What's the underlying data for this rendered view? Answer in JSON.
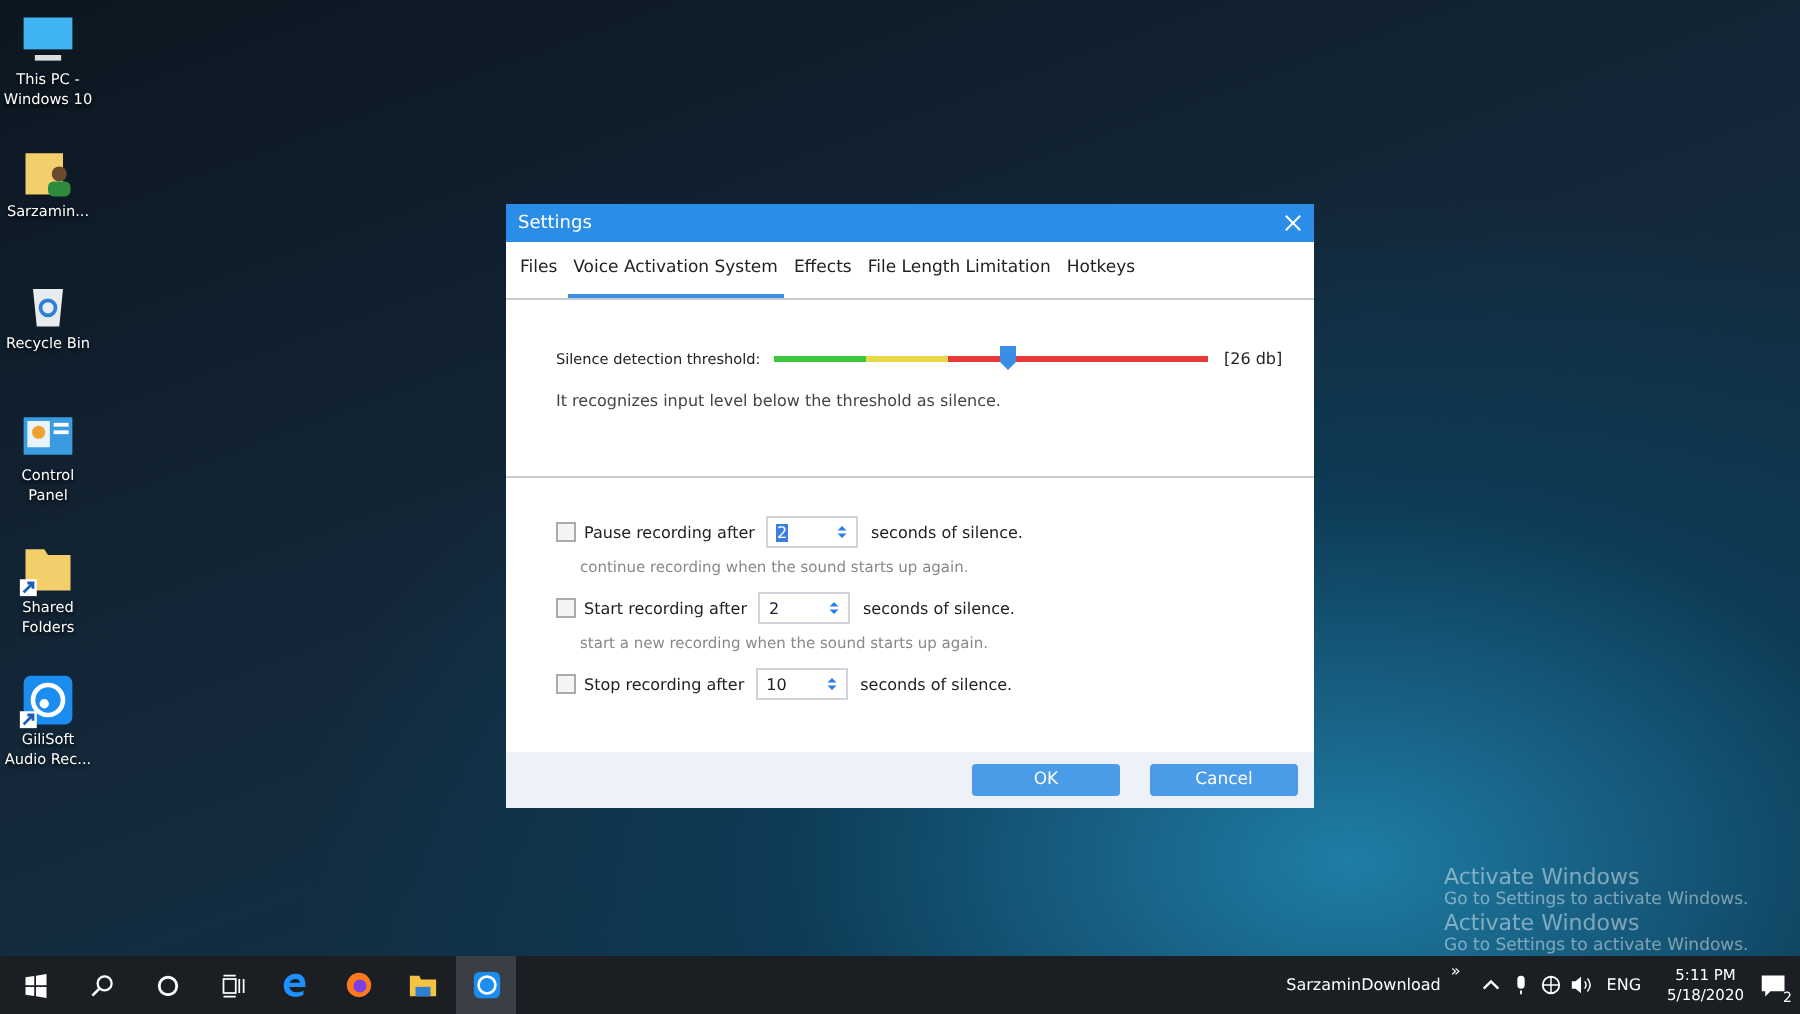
{
  "desktop_icons": [
    {
      "kind": "pc",
      "label": "This PC - Windows 10",
      "shortcut": false
    },
    {
      "kind": "user-folder",
      "label": "Sarzamin...",
      "shortcut": false
    },
    {
      "kind": "recycle-bin",
      "label": "Recycle Bin",
      "shortcut": false
    },
    {
      "kind": "control-panel",
      "label": "Control Panel",
      "shortcut": false
    },
    {
      "kind": "folder",
      "label": "Shared Folders",
      "shortcut": true
    },
    {
      "kind": "app",
      "label": "GiliSoft Audio Rec...",
      "shortcut": true
    }
  ],
  "watermark": [
    "Activate Windows",
    "Go to Settings to activate Windows.",
    "Activate Windows",
    "Go to Settings to activate Windows."
  ],
  "dialog": {
    "title": "Settings",
    "tabs": [
      {
        "label": "Files",
        "selected": false
      },
      {
        "label": "Voice Activation System",
        "selected": true
      },
      {
        "label": "Effects",
        "selected": false
      },
      {
        "label": "File Length Limitation",
        "selected": false
      },
      {
        "label": "Hotkeys",
        "selected": false
      }
    ],
    "threshold": {
      "label": "Silence detection threshold:",
      "level": 0.54,
      "reading": "[26 db]",
      "hint": "It recognizes input level below the threshold as silence."
    },
    "options": [
      {
        "label": "Pause recording after",
        "value": "2",
        "suffix": "seconds of silence.",
        "checked": false,
        "hint": "continue recording when the sound starts up again."
      },
      {
        "label": "Start recording after",
        "value": "2",
        "suffix": "seconds of silence.",
        "checked": false,
        "hint": "start a new recording when the sound starts up again."
      },
      {
        "label": "Stop recording after",
        "value": "10",
        "suffix": "seconds of silence.",
        "checked": false
      }
    ],
    "buttons": [
      "OK",
      "Cancel"
    ]
  },
  "taskbar": {
    "apps": [
      {
        "kind": "edge",
        "active": false
      },
      {
        "kind": "firefox",
        "active": false
      },
      {
        "kind": "explorer",
        "active": false
      },
      {
        "kind": "recorder",
        "active": true
      }
    ],
    "toolbar_label": "SarzaminDownload",
    "toolbar_chevron": "»",
    "language": "ENG",
    "time": "5:11 PM",
    "date": "5/18/2020",
    "notifications": "2"
  }
}
